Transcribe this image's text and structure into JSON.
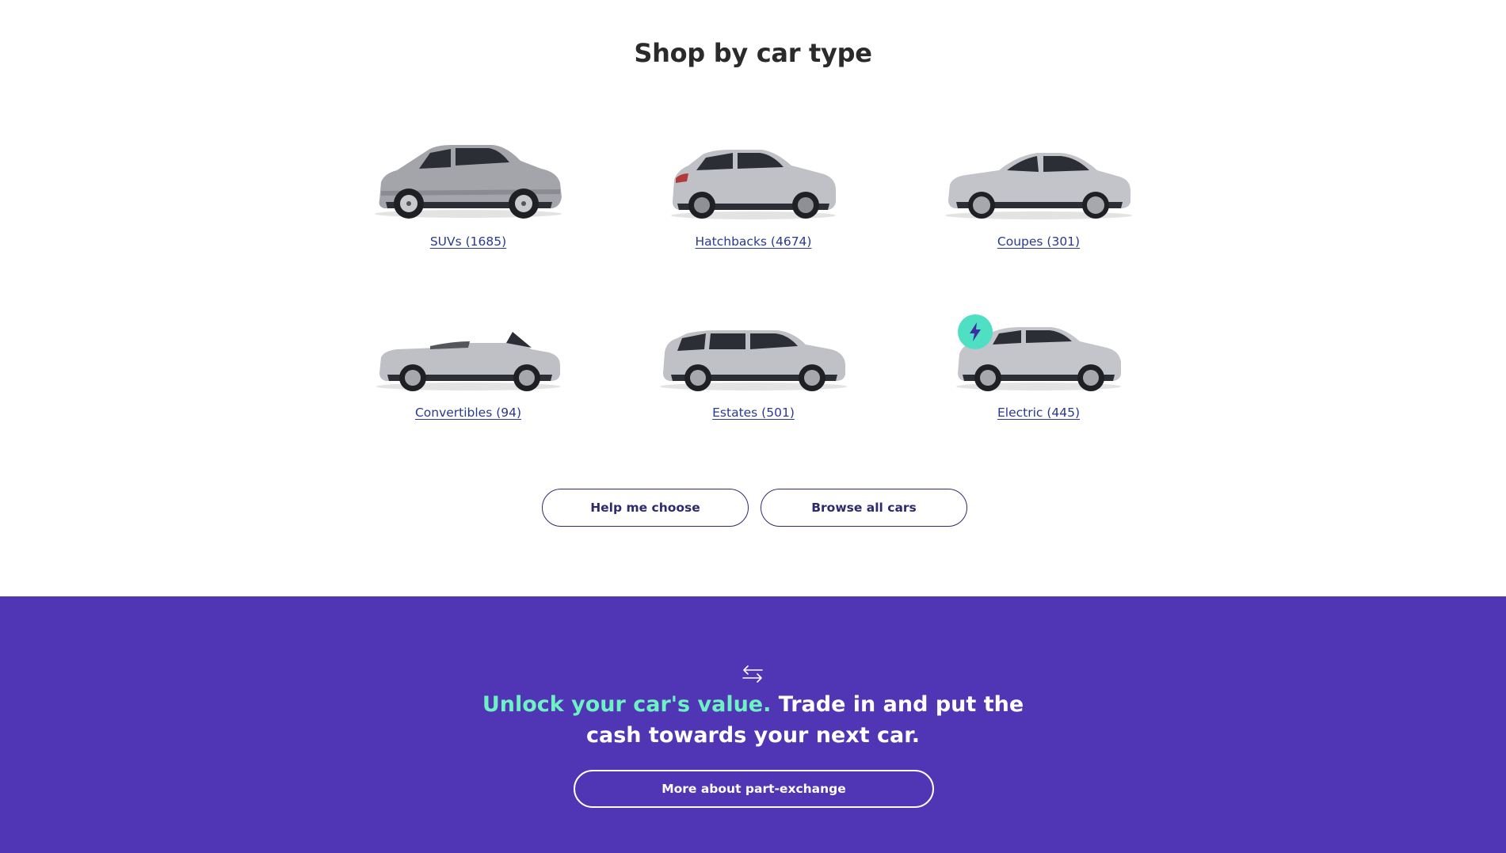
{
  "shop": {
    "title": "Shop by car type",
    "categories": [
      {
        "label": "SUVs (1685)",
        "icon": "suv-car-image"
      },
      {
        "label": "Hatchbacks (4674)",
        "icon": "hatchback-car-image"
      },
      {
        "label": "Coupes (301)",
        "icon": "coupe-car-image"
      },
      {
        "label": "Convertibles (94)",
        "icon": "convertible-car-image"
      },
      {
        "label": "Estates (501)",
        "icon": "estate-car-image"
      },
      {
        "label": "Electric (445)",
        "icon": "electric-car-image",
        "badge_icon": "lightning-bolt-icon"
      }
    ],
    "buttons": {
      "help": "Help me choose",
      "browse": "Browse all cars"
    }
  },
  "part_exchange": {
    "icon": "swap-arrows-icon",
    "headline_highlight": "Unlock your car's value.",
    "headline_rest_line1": "Trade in and put the",
    "headline_line2": "cash towards your next car.",
    "button": "More about part-exchange"
  },
  "colors": {
    "link": "#2a3a8c",
    "button_border": "#2b2b6e",
    "band_background": "#5035b5",
    "highlight": "#6ef2c4",
    "ev_badge": "#4fe0c4"
  }
}
